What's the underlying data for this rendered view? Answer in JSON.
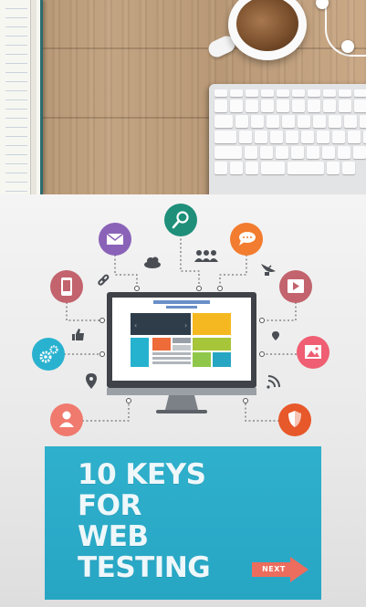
{
  "title": {
    "line1": "10 KEYS",
    "line2": "FOR",
    "line3": "WEB",
    "line4": "TESTING"
  },
  "next_button": {
    "label": "NEXT"
  },
  "colors": {
    "purple": "#8a63b8",
    "teal": "#1f8f7a",
    "orange": "#f27c2f",
    "rose": "#c2636d",
    "cyan": "#29b2cf",
    "pink": "#ef5e72",
    "coral": "#f07a6e",
    "deep_orange": "#e7582a",
    "card_blue": "#2aa9c7",
    "next_red": "#ec6d5d"
  },
  "icons": [
    "envelope-icon",
    "magnifier-icon",
    "chat-bubble-icon",
    "cloud-icon",
    "users-icon",
    "mobile-phone-icon",
    "link-icon",
    "satellite-dish-icon",
    "video-player-icon",
    "thumbs-up-icon",
    "gears-icon",
    "location-pin-icon",
    "image-icon",
    "rss-feed-icon",
    "user-icon",
    "shield-icon",
    "monitor-icon"
  ]
}
